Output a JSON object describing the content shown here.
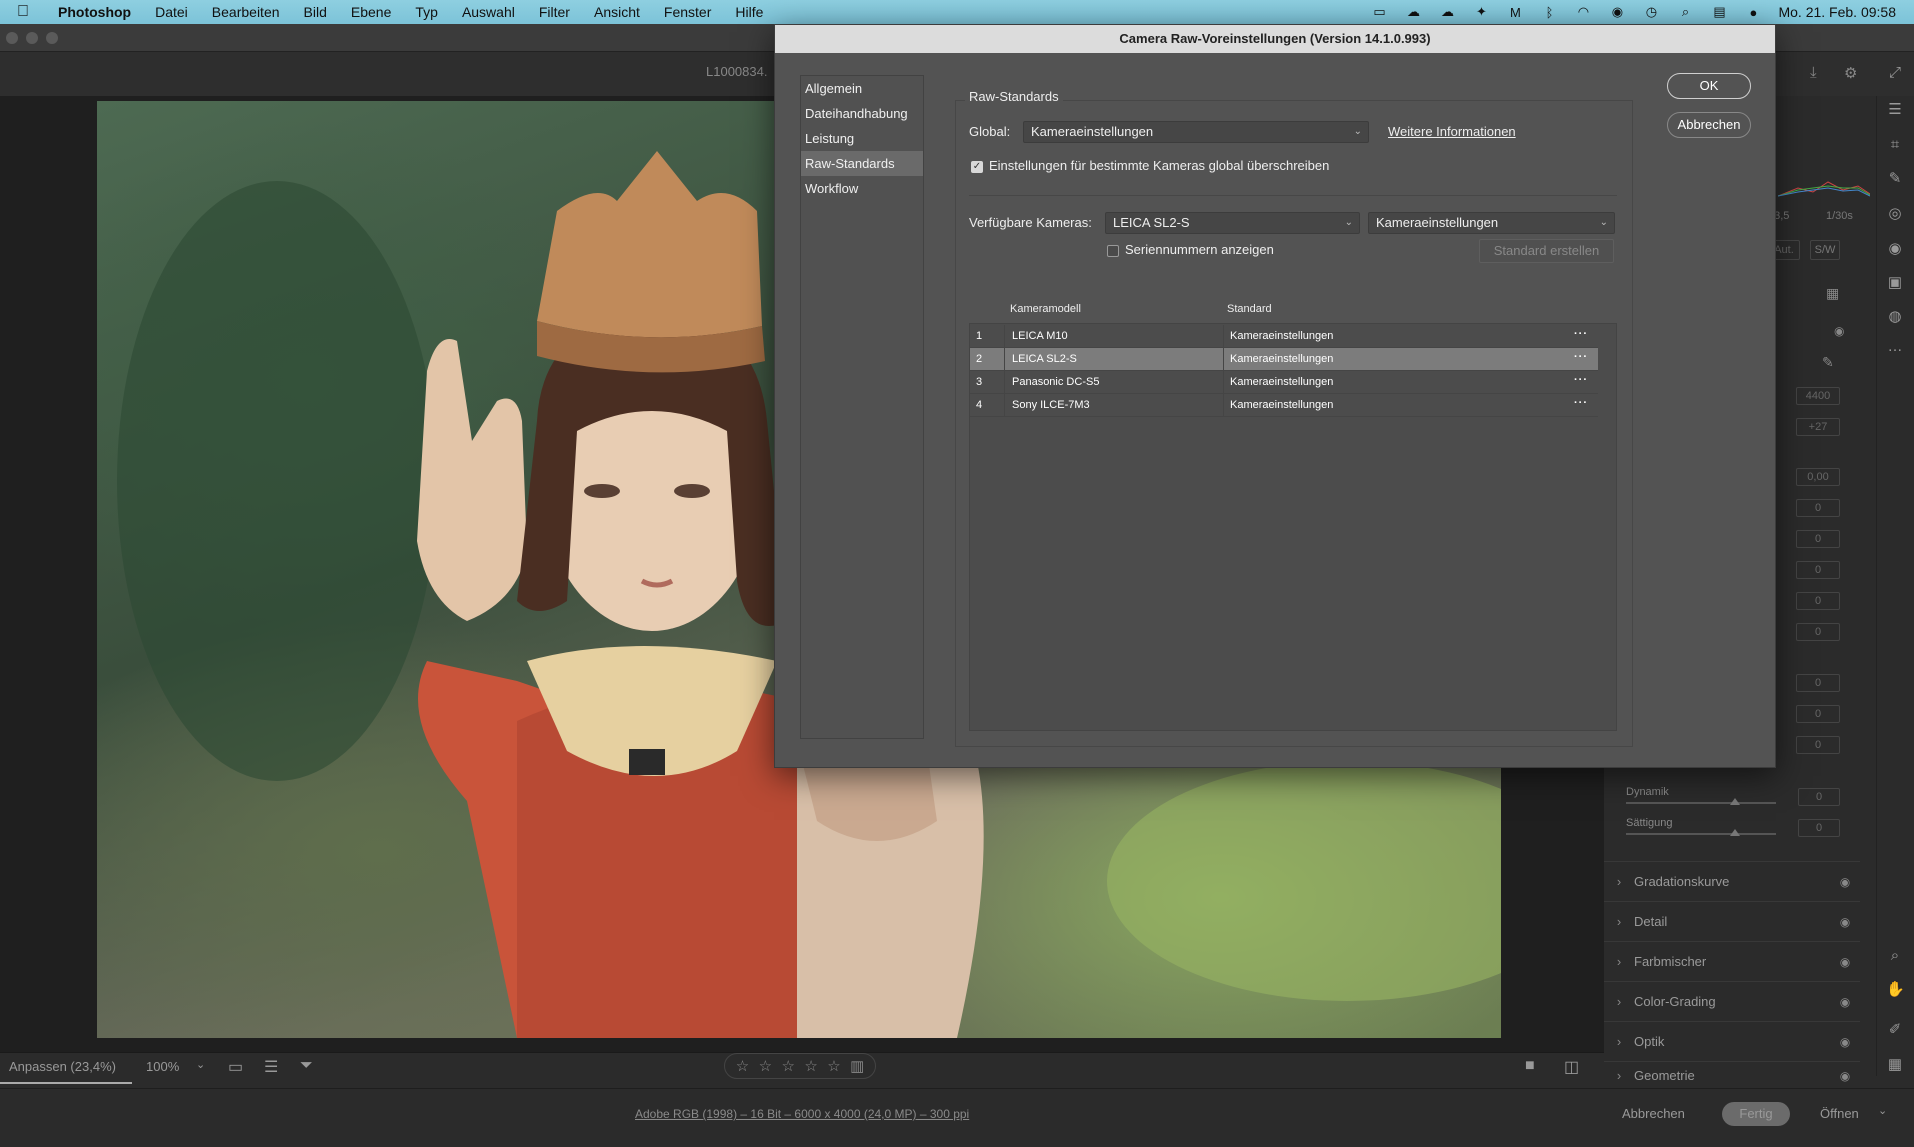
{
  "menubar": {
    "app": "Photoshop",
    "items": [
      "Datei",
      "Bearbeiten",
      "Bild",
      "Ebene",
      "Typ",
      "Auswahl",
      "Filter",
      "Ansicht",
      "Fenster",
      "Hilfe"
    ],
    "clock": "Mo. 21. Feb. 09:58"
  },
  "document": {
    "name": "L1000834."
  },
  "dialog": {
    "title": "Camera Raw-Voreinstellungen  (Version 14.1.0.993)",
    "nav": [
      "Allgemein",
      "Dateihandhabung",
      "Leistung",
      "Raw-Standards",
      "Workflow"
    ],
    "nav_active": 3,
    "section_title": "Raw-Standards",
    "global_label": "Global:",
    "global_value": "Kameraeinstellungen",
    "more_info_link": "Weitere Informationen",
    "override_label": "Einstellungen für bestimmte Kameras global überschreiben",
    "override_checked": true,
    "cameras_label": "Verfügbare Kameras:",
    "camera_value": "LEICA SL2-S",
    "camera_setting_value": "Kameraeinstellungen",
    "serial_label": "Seriennummern anzeigen",
    "serial_checked": false,
    "create_default_button": "Standard erstellen",
    "ok_button": "OK",
    "cancel_button": "Abbrechen",
    "table": {
      "headers": [
        "Kameramodell",
        "Standard"
      ],
      "rows": [
        {
          "num": "1",
          "model": "LEICA M10",
          "standard": "Kameraeinstellungen",
          "selected": false
        },
        {
          "num": "2",
          "model": "LEICA SL2-S",
          "standard": "Kameraeinstellungen",
          "selected": true
        },
        {
          "num": "3",
          "model": "Panasonic DC-S5",
          "standard": "Kameraeinstellungen",
          "selected": false
        },
        {
          "num": "4",
          "model": "Sony ILCE-7M3",
          "standard": "Kameraeinstellungen",
          "selected": false
        }
      ]
    }
  },
  "right_panel": {
    "exposure_info": [
      "f/3,5",
      "1/30s"
    ],
    "profile_buttons": [
      "Aut.",
      "S/W"
    ],
    "slider_values": [
      "4400",
      "+27",
      "0,00",
      "0",
      "0",
      "0",
      "0",
      "0",
      "0",
      "0",
      "0"
    ],
    "sliders": [
      {
        "label": "Dynamik",
        "value": "0"
      },
      {
        "label": "Sättigung",
        "value": "0"
      }
    ],
    "sections": [
      "Gradationskurve",
      "Detail",
      "Farbmischer",
      "Color-Grading",
      "Optik",
      "Geometrie"
    ]
  },
  "bottom": {
    "zoom_fit": "Anpassen (23,4%)",
    "zoom_pct": "100%",
    "file_info": "Adobe RGB (1998) – 16 Bit – 6000 x 4000 (24,0 MP) – 300 ppi",
    "cancel": "Abbrechen",
    "done": "Fertig",
    "open": "Öffnen"
  }
}
